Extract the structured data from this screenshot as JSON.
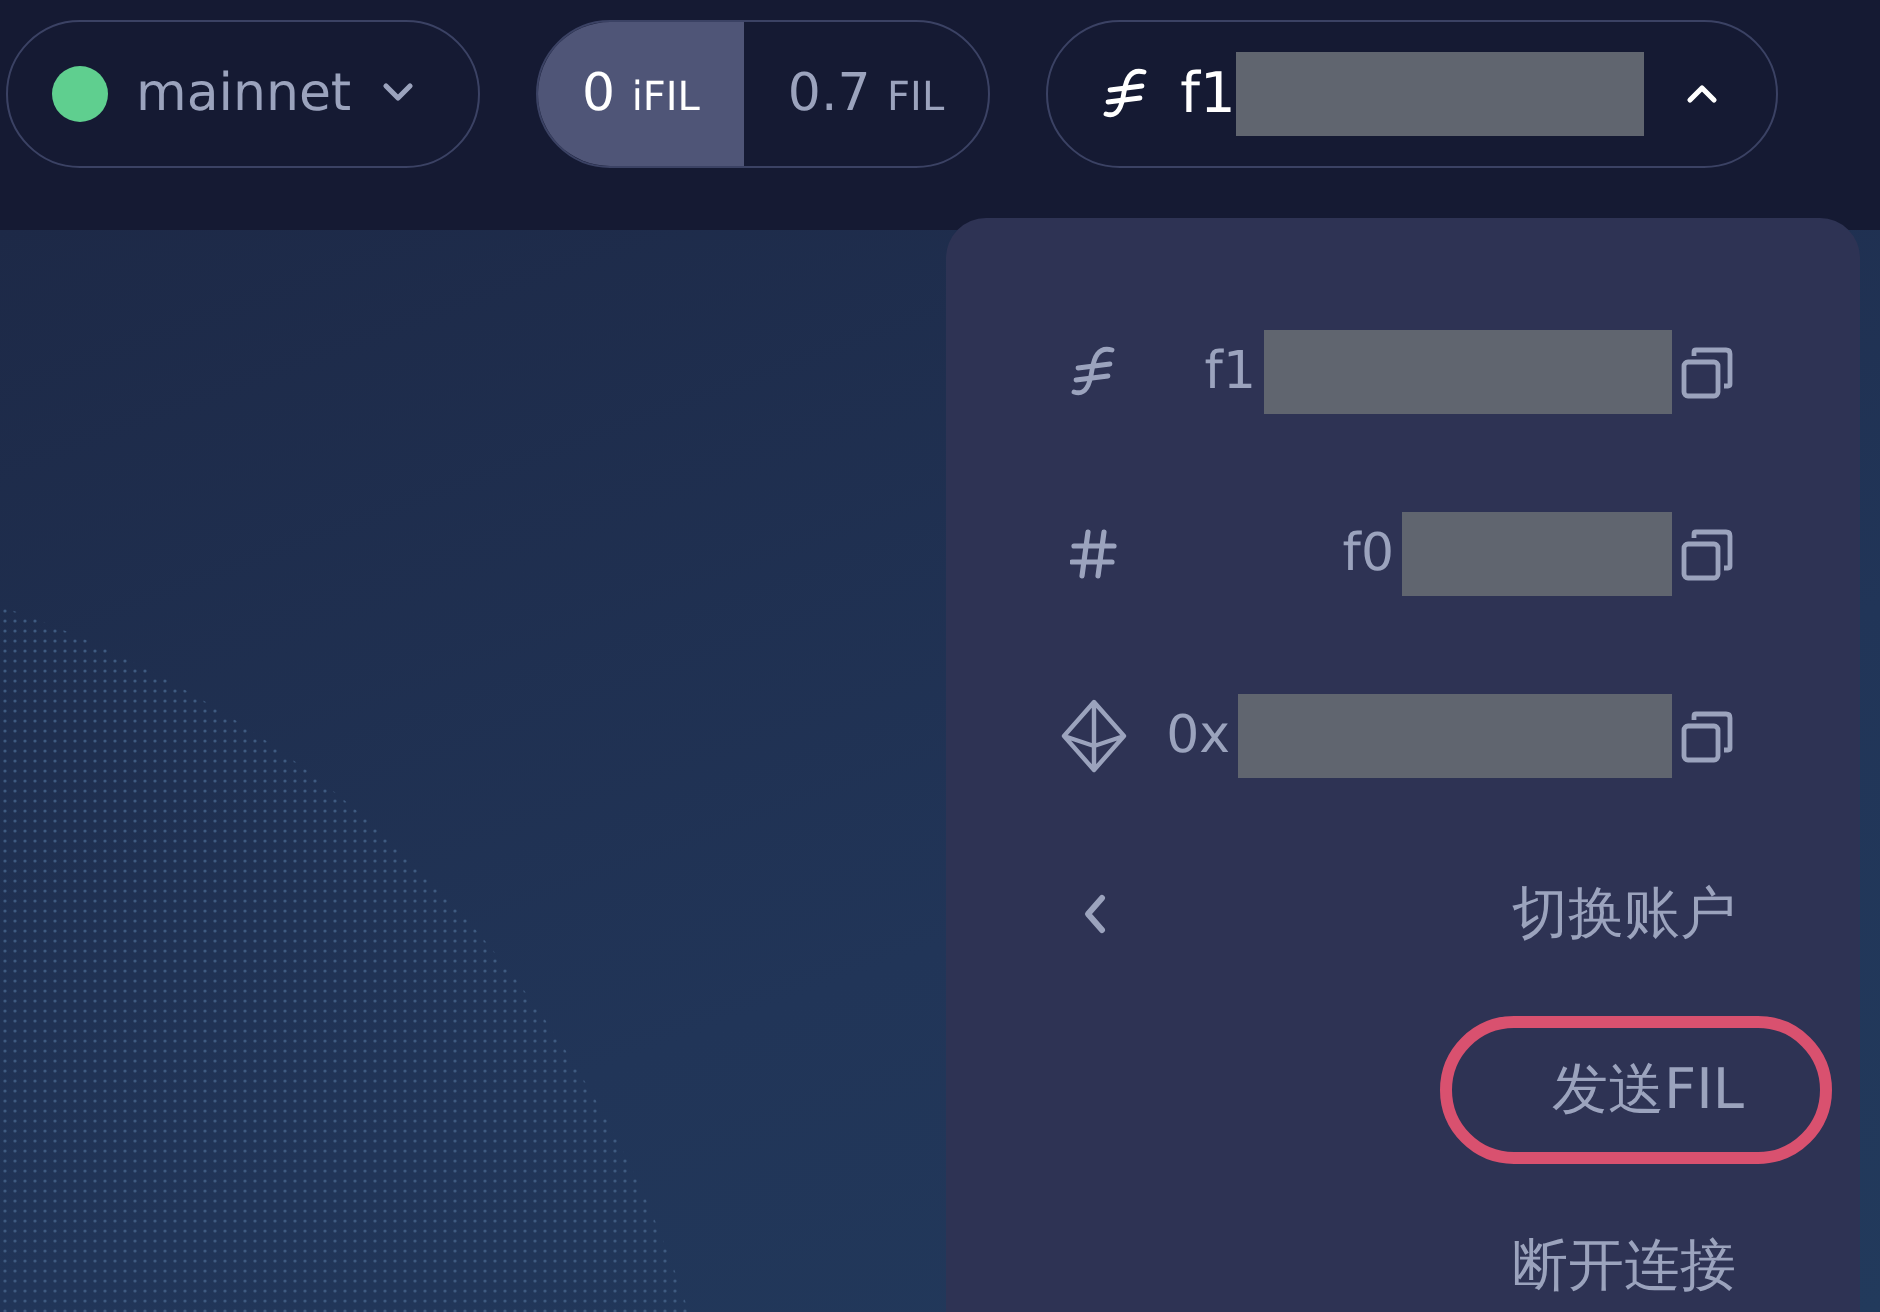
{
  "network": {
    "name": "mainnet",
    "expanded": false
  },
  "balances": [
    {
      "amount": "0",
      "unit": "iFIL",
      "selected": true
    },
    {
      "amount": "0.7",
      "unit": "FIL",
      "selected": false
    }
  ],
  "account": {
    "address": "f1",
    "expanded": true
  },
  "menu": {
    "addresses": [
      {
        "kind": "filecoin",
        "text": "f1"
      },
      {
        "kind": "id",
        "text": "f0"
      },
      {
        "kind": "eth",
        "text": "0x"
      }
    ],
    "actions": [
      {
        "kind": "switch",
        "label": "切换账户",
        "highlighted": false
      },
      {
        "kind": "send",
        "label": "发送FIL",
        "highlighted": true
      },
      {
        "kind": "disconnect",
        "label": "断开连接",
        "highlighted": false
      }
    ]
  }
}
